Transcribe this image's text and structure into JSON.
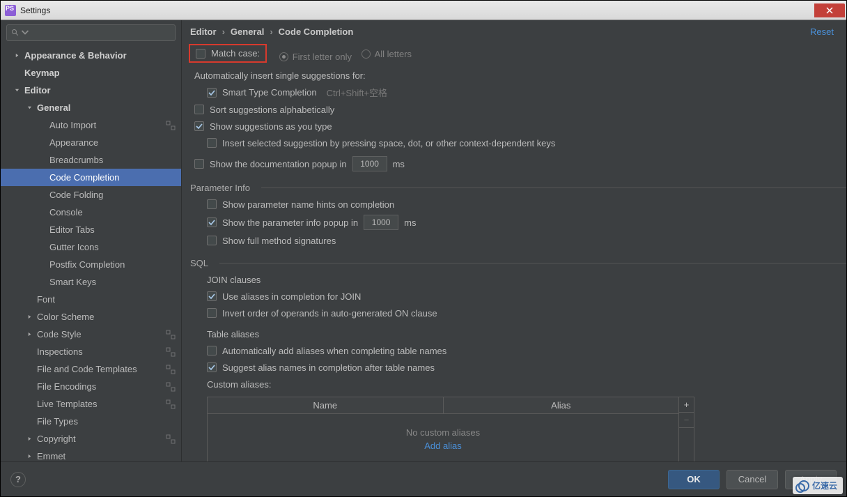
{
  "window": {
    "title": "Settings"
  },
  "actions": {
    "reset": "Reset",
    "ok": "OK",
    "cancel": "Cancel",
    "apply": "Apply"
  },
  "crumbs": [
    "Editor",
    "General",
    "Code Completion"
  ],
  "sidebar": {
    "items": [
      {
        "label": "Appearance & Behavior",
        "level": 0,
        "bold": true,
        "arrow": "right",
        "badge": false
      },
      {
        "label": "Keymap",
        "level": 0,
        "bold": true,
        "arrow": "",
        "badge": false
      },
      {
        "label": "Editor",
        "level": 0,
        "bold": true,
        "arrow": "down",
        "badge": false
      },
      {
        "label": "General",
        "level": 1,
        "bold": true,
        "arrow": "down",
        "badge": false
      },
      {
        "label": "Auto Import",
        "level": 2,
        "arrow": "",
        "badge": true
      },
      {
        "label": "Appearance",
        "level": 2,
        "arrow": "",
        "badge": false
      },
      {
        "label": "Breadcrumbs",
        "level": 2,
        "arrow": "",
        "badge": false
      },
      {
        "label": "Code Completion",
        "level": 2,
        "arrow": "",
        "badge": false,
        "selected": true
      },
      {
        "label": "Code Folding",
        "level": 2,
        "arrow": "",
        "badge": false
      },
      {
        "label": "Console",
        "level": 2,
        "arrow": "",
        "badge": false
      },
      {
        "label": "Editor Tabs",
        "level": 2,
        "arrow": "",
        "badge": false
      },
      {
        "label": "Gutter Icons",
        "level": 2,
        "arrow": "",
        "badge": false
      },
      {
        "label": "Postfix Completion",
        "level": 2,
        "arrow": "",
        "badge": false
      },
      {
        "label": "Smart Keys",
        "level": 2,
        "arrow": "",
        "badge": false
      },
      {
        "label": "Font",
        "level": 1,
        "arrow": "",
        "badge": false
      },
      {
        "label": "Color Scheme",
        "level": 1,
        "arrow": "right",
        "badge": false
      },
      {
        "label": "Code Style",
        "level": 1,
        "arrow": "right",
        "badge": true
      },
      {
        "label": "Inspections",
        "level": 1,
        "arrow": "",
        "badge": true
      },
      {
        "label": "File and Code Templates",
        "level": 1,
        "arrow": "",
        "badge": true
      },
      {
        "label": "File Encodings",
        "level": 1,
        "arrow": "",
        "badge": true
      },
      {
        "label": "Live Templates",
        "level": 1,
        "arrow": "",
        "badge": true
      },
      {
        "label": "File Types",
        "level": 1,
        "arrow": "",
        "badge": false
      },
      {
        "label": "Copyright",
        "level": 1,
        "arrow": "right",
        "badge": true
      },
      {
        "label": "Emmet",
        "level": 1,
        "arrow": "right",
        "badge": false
      }
    ]
  },
  "match": {
    "label": "Match case:",
    "first": "First letter only",
    "all": "All letters"
  },
  "opts": {
    "autoInsertTitle": "Automatically insert single suggestions for:",
    "smartType": "Smart Type Completion",
    "smartTypeHint": "Ctrl+Shift+空格",
    "sortAlpha": "Sort suggestions alphabetically",
    "showSuggestions": "Show suggestions as you type",
    "insertSel": "Insert selected suggestion by pressing space, dot, or other context-dependent keys",
    "showDocPopup": "Show the documentation popup in",
    "docDelay": "1000",
    "ms": "ms"
  },
  "param": {
    "title": "Parameter Info",
    "showHints": "Show parameter name hints on completion",
    "showPopup": "Show the parameter info popup in",
    "delay": "1000",
    "showFull": "Show full method signatures"
  },
  "sql": {
    "title": "SQL",
    "join": "JOIN clauses",
    "useAliases": "Use aliases in completion for JOIN",
    "invert": "Invert order of operands in auto-generated ON clause",
    "tableAliases": "Table aliases",
    "autoAdd": "Automatically add aliases when completing table names",
    "suggest": "Suggest alias names in completion after table names",
    "customTitle": "Custom aliases:",
    "colName": "Name",
    "colAlias": "Alias",
    "empty": "No custom aliases",
    "addLink": "Add alias"
  },
  "overlay": {
    "text": "亿速云"
  }
}
